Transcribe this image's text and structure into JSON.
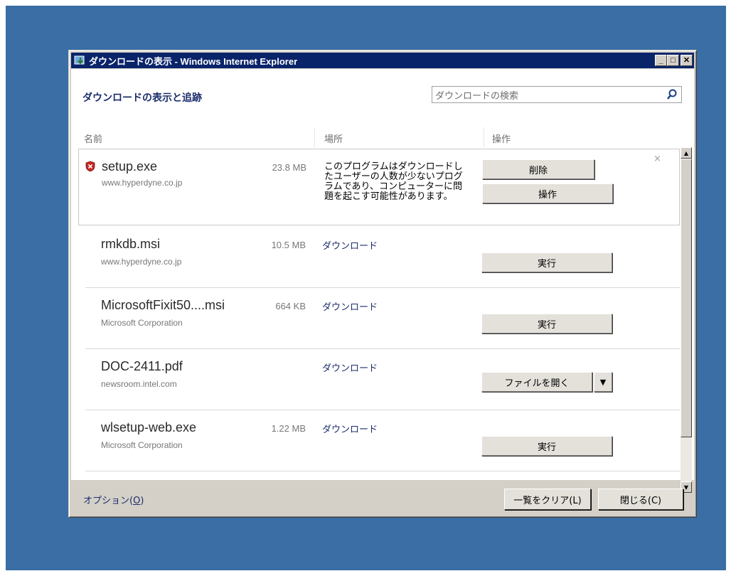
{
  "window": {
    "title": "ダウンロードの表示 - Windows Internet Explorer",
    "minimize_symbol": "_",
    "maximize_symbol": "□",
    "close_symbol": "✕"
  },
  "header": {
    "title": "ダウンロードの表示と追跡",
    "search_placeholder": "ダウンロードの検索"
  },
  "columns": {
    "name": "名前",
    "location": "場所",
    "action": "操作"
  },
  "downloads": [
    {
      "name": "setup.exe",
      "source": "www.hyperdyne.co.jp",
      "size": "23.8 MB",
      "warning": "このプログラムはダウンロードしたユーザーの人数が少ないプログラムであり、コンピューターに問題を起こす可能性があります。",
      "buttons": [
        "削除",
        "操作"
      ],
      "dismiss": "×"
    },
    {
      "name": "rmkdb.msi",
      "source": "www.hyperdyne.co.jp",
      "size": "10.5 MB",
      "location": "ダウンロード",
      "button": "実行"
    },
    {
      "name": "MicrosoftFixit50....msi",
      "source": "Microsoft Corporation",
      "size": "664 KB",
      "location": "ダウンロード",
      "button": "実行"
    },
    {
      "name": "DOC-2411.pdf",
      "source": "newsroom.intel.com",
      "size": "",
      "location": "ダウンロード",
      "button": "ファイルを開く",
      "dropdown": "▼"
    },
    {
      "name": "wlsetup-web.exe",
      "source": "Microsoft Corporation",
      "size": "1.22 MB",
      "location": "ダウンロード",
      "button": "実行"
    }
  ],
  "footer": {
    "options_text": "オプション(",
    "options_key": "O",
    "options_close": ")",
    "clear_list": "一覧をクリア(L)",
    "close": "閉じる(C)"
  },
  "scrollbar": {
    "up_symbol": "▲",
    "down_symbol": "▼"
  },
  "colors": {
    "desktop": "#3a6ea5",
    "titlebar": "#0a246a",
    "link": "#1b2e6b"
  }
}
